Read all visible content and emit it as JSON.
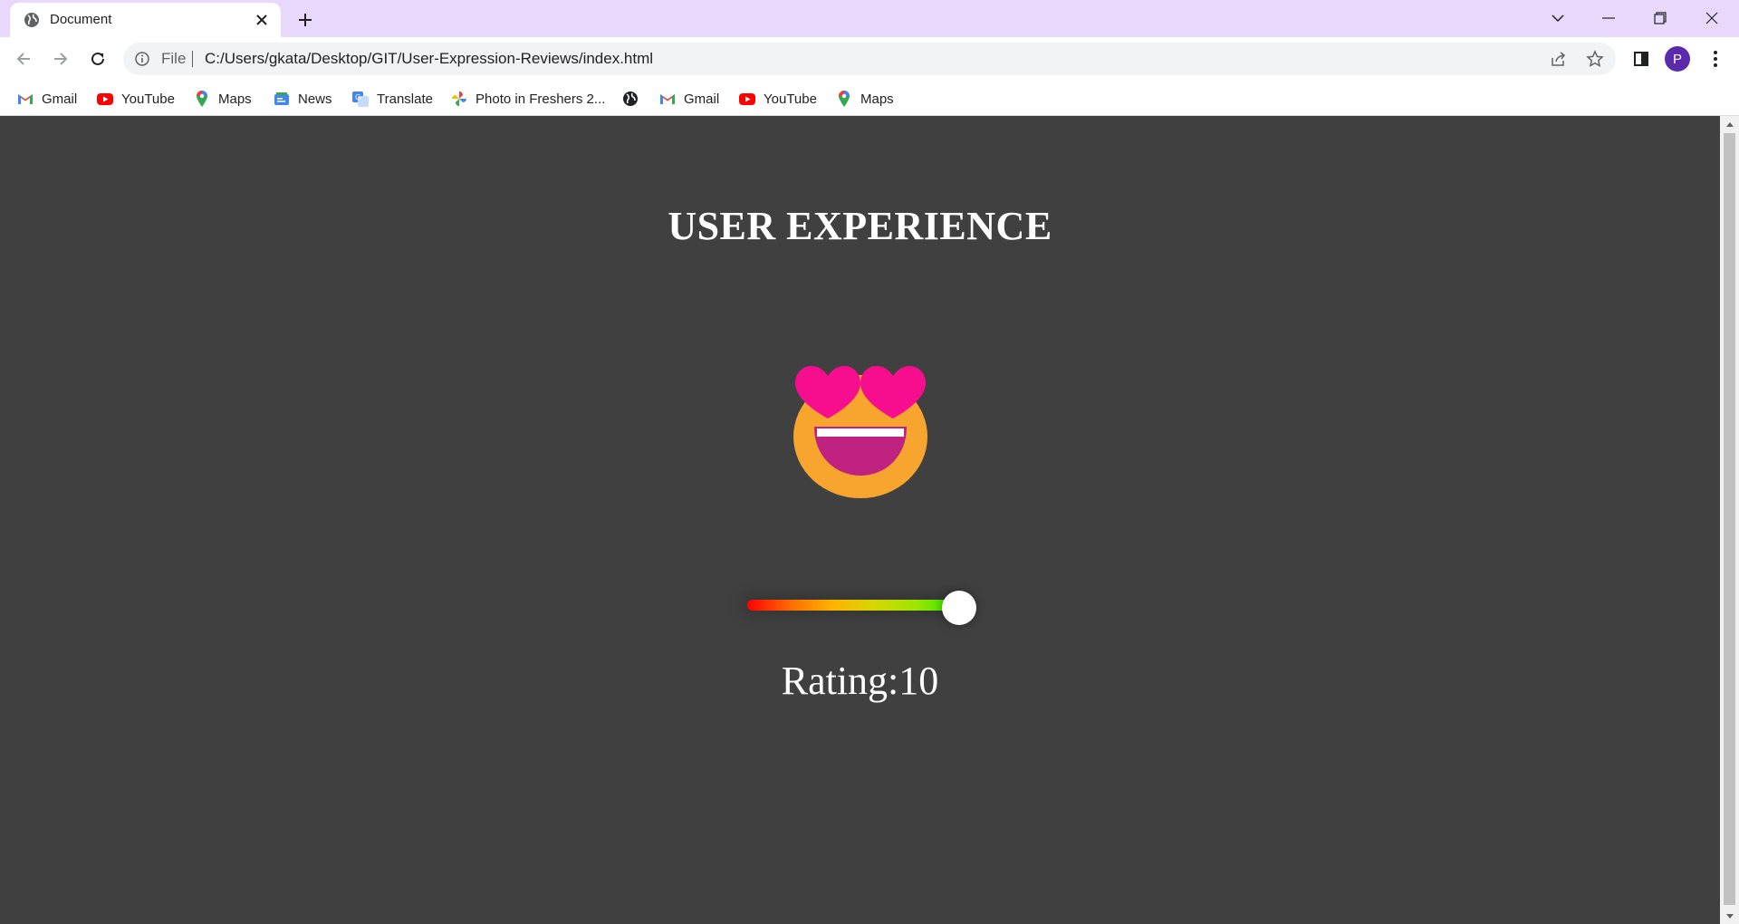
{
  "browser": {
    "tab": {
      "title": "Document",
      "icon": "globe-icon"
    },
    "omnibox": {
      "scheme_label": "File",
      "url": "C:/Users/gkata/Desktop/GIT/User-Expression-Reviews/index.html"
    },
    "profile_initial": "P",
    "bookmarks": [
      {
        "label": "Gmail",
        "icon": "gmail-icon"
      },
      {
        "label": "YouTube",
        "icon": "youtube-icon"
      },
      {
        "label": "Maps",
        "icon": "maps-icon"
      },
      {
        "label": "News",
        "icon": "news-icon"
      },
      {
        "label": "Translate",
        "icon": "translate-icon"
      },
      {
        "label": "Photo in Freshers 2...",
        "icon": "photos-icon"
      },
      {
        "label": "",
        "icon": "globe-icon"
      },
      {
        "label": "Gmail",
        "icon": "gmail-icon"
      },
      {
        "label": "YouTube",
        "icon": "youtube-icon"
      },
      {
        "label": "Maps",
        "icon": "maps-icon"
      }
    ]
  },
  "page": {
    "title": "USER EXPERIENCE",
    "emoji": "smiling-face-with-heart-eyes-icon",
    "rating_label": "Rating:10",
    "slider": {
      "min": 0,
      "max": 10,
      "value": 10
    },
    "colors": {
      "background": "#404040",
      "text": "#ffffff",
      "emoji_face": "#f7a52e",
      "emoji_hearts": "#f70e8e",
      "emoji_mouth": "#c0227f"
    }
  }
}
